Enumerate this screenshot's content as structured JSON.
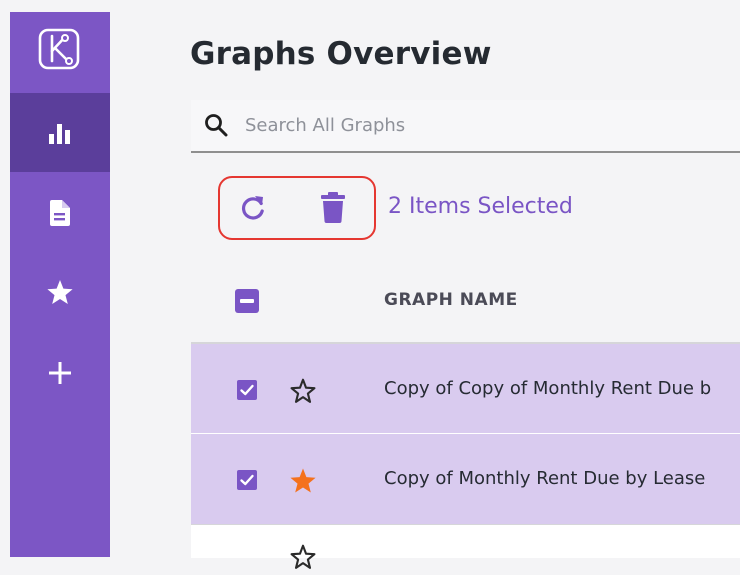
{
  "sidebar": {
    "logo_icon": "kuber-logo-icon",
    "items": [
      {
        "icon": "bar-chart-icon",
        "active": true
      },
      {
        "icon": "document-icon",
        "active": false
      },
      {
        "icon": "star-icon",
        "active": false
      },
      {
        "icon": "plus-icon",
        "active": false
      }
    ]
  },
  "page": {
    "title": "Graphs Overview"
  },
  "search": {
    "placeholder": "Search All Graphs",
    "value": ""
  },
  "selection": {
    "label": "2 Items Selected"
  },
  "table": {
    "header": {
      "name": "GRAPH NAME"
    },
    "rows": [
      {
        "name": "Copy of Copy of Monthly Rent Due b",
        "checked": true,
        "starred": false
      },
      {
        "name": "Copy of Monthly Rent Due by Lease",
        "checked": true,
        "starred": true
      }
    ]
  },
  "colors": {
    "accent": "#7a55c5",
    "sidebar": "#7c56c5",
    "sidebar_active": "#5b3e9b",
    "selected_row": "#d9cbef",
    "star_filled": "#f4711d",
    "highlight_border": "#e53731"
  }
}
